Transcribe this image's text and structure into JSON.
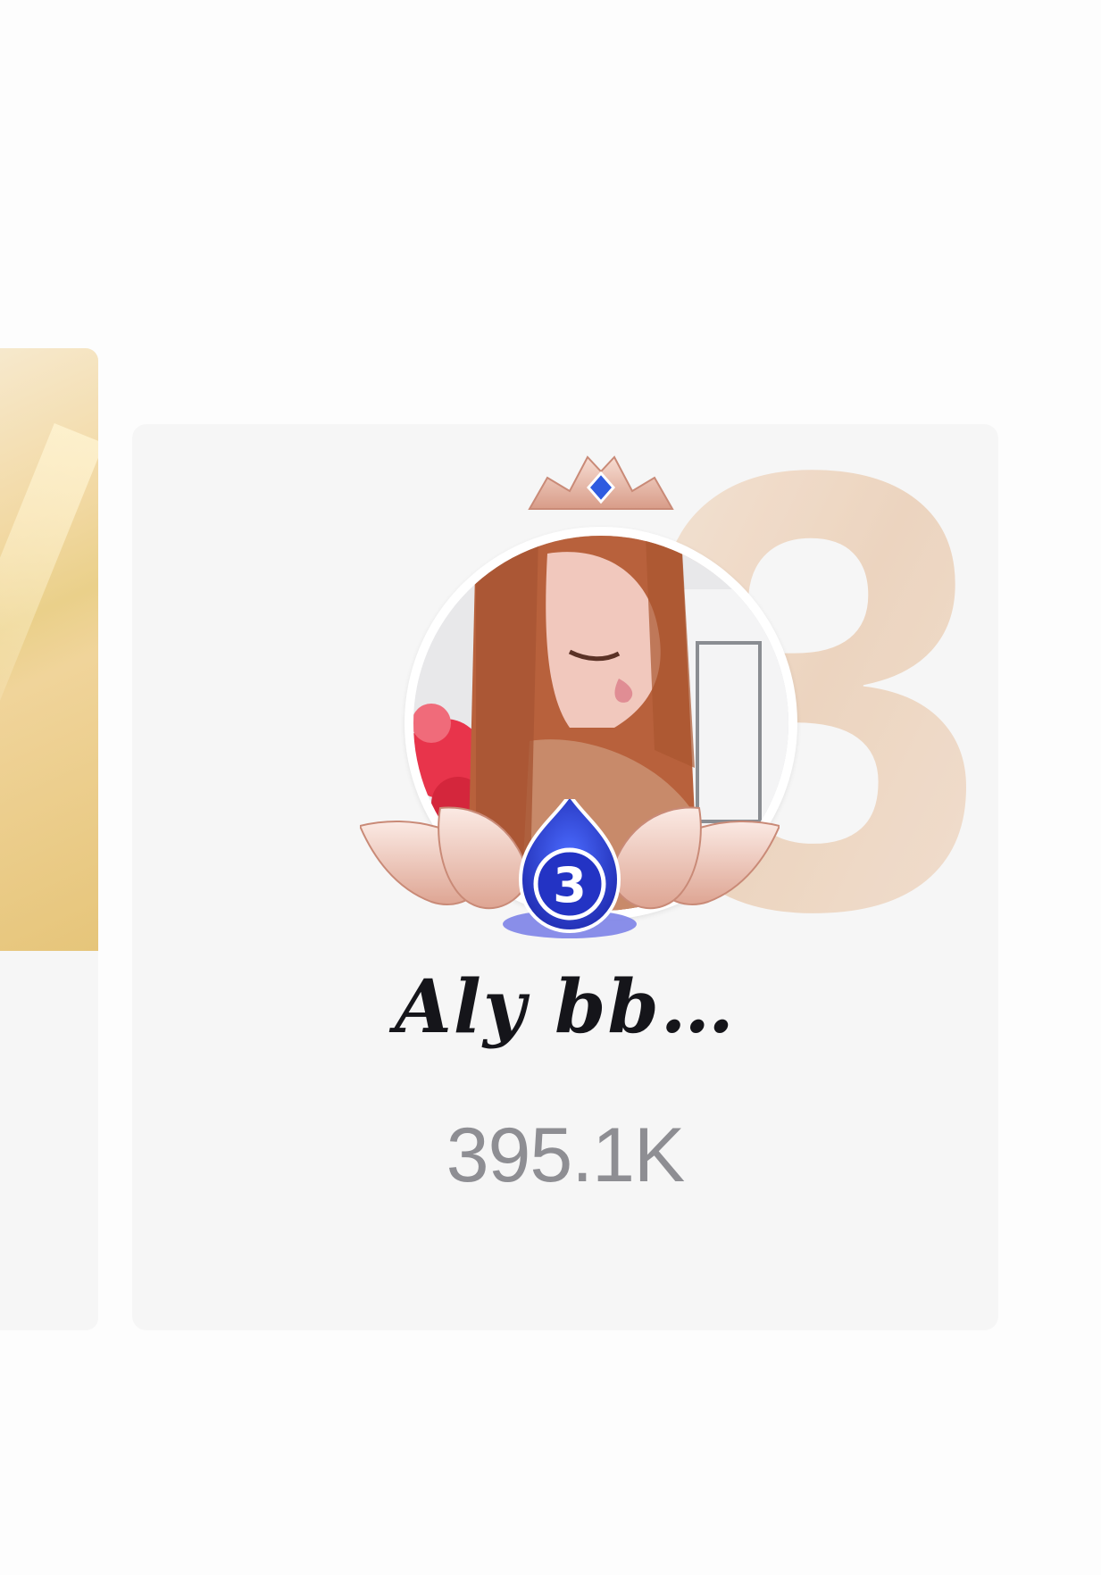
{
  "ranking_card": {
    "rank": "3",
    "rank_badge": "3",
    "username": "Aly bb…",
    "score": "395.1K"
  },
  "colors": {
    "card_background": "#f6f6f6",
    "rank_watermark": "#ecd3bd",
    "name_text": "#15151a",
    "score_text": "#8e8e93",
    "badge_blue": "#2f3fd6",
    "crown_rose": "#e8b3a3",
    "left_card_gold": "#ead08a"
  },
  "icons": {
    "crown": "crown-icon",
    "lotus_frame": "lotus-frame-icon",
    "rank_badge": "rank-badge-icon"
  }
}
